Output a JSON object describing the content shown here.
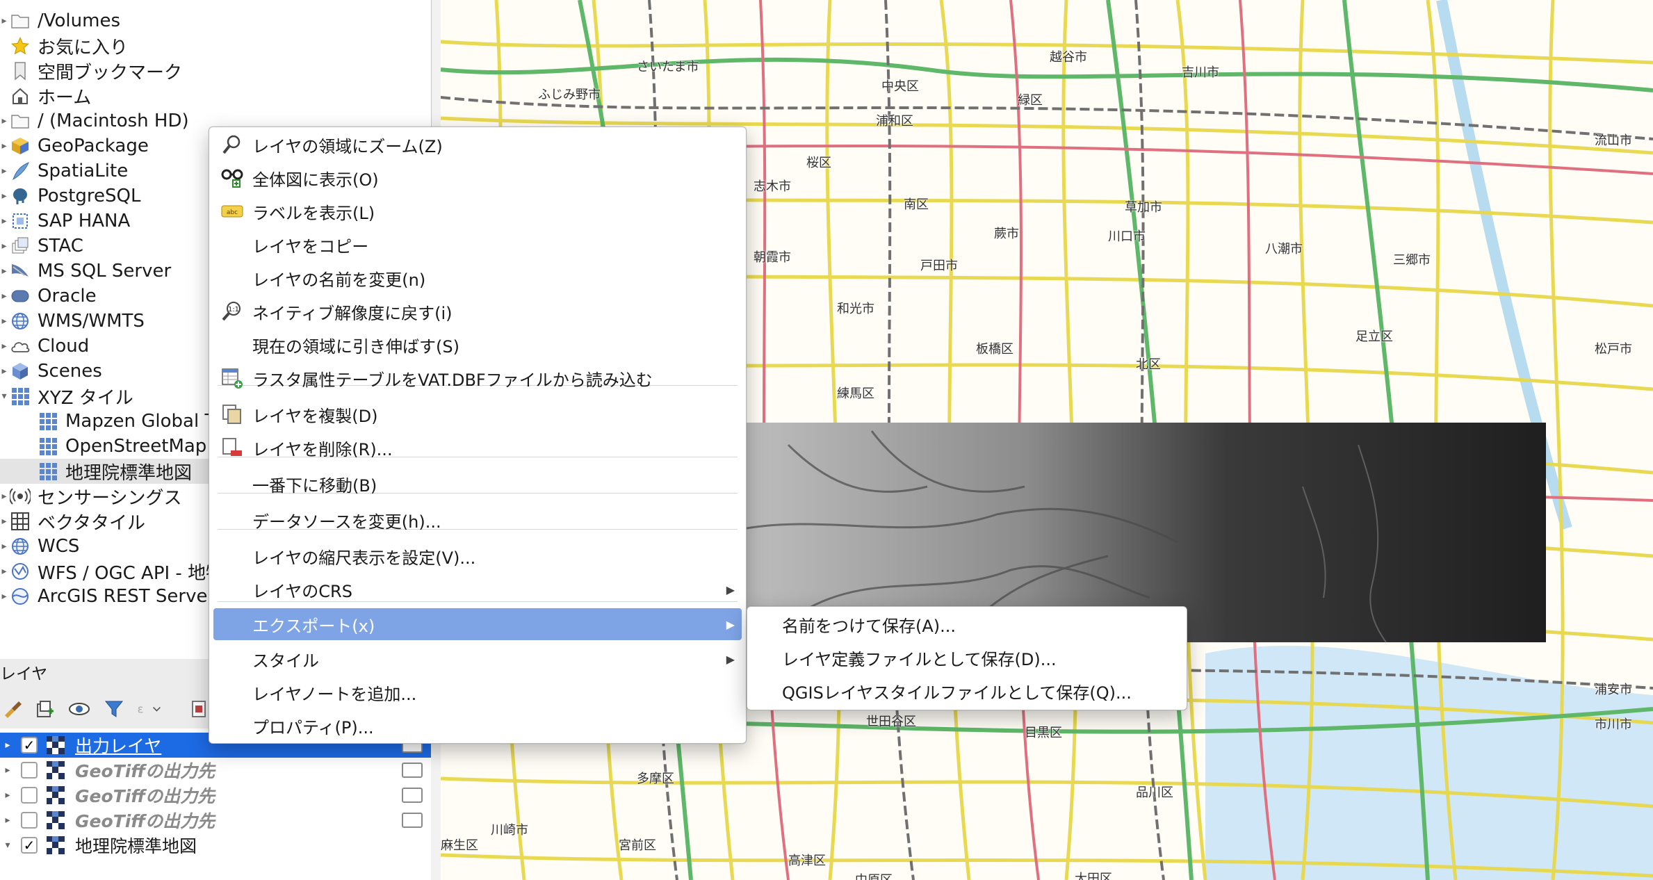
{
  "browser": {
    "items": [
      {
        "label": "/Volumes",
        "icon": "folder-icon"
      },
      {
        "label": "お気に入り",
        "icon": "star-icon"
      },
      {
        "label": "空間ブックマーク",
        "icon": "bookmark-icon"
      },
      {
        "label": "ホーム",
        "icon": "home-icon"
      },
      {
        "label": "/ (Macintosh HD)",
        "icon": "folder-icon"
      },
      {
        "label": "GeoPackage",
        "icon": "geopackage-icon"
      },
      {
        "label": "SpatiaLite",
        "icon": "spatialite-icon"
      },
      {
        "label": "PostgreSQL",
        "icon": "postgresql-icon"
      },
      {
        "label": "SAP HANA",
        "icon": "sap-hana-icon"
      },
      {
        "label": "STAC",
        "icon": "stac-icon"
      },
      {
        "label": "MS SQL Server",
        "icon": "mssql-icon"
      },
      {
        "label": "Oracle",
        "icon": "oracle-icon"
      },
      {
        "label": "WMS/WMTS",
        "icon": "globe-icon"
      },
      {
        "label": "Cloud",
        "icon": "cloud-icon"
      },
      {
        "label": "Scenes",
        "icon": "cube-icon"
      },
      {
        "label": "XYZ タイル",
        "icon": "grid-icon"
      },
      {
        "label": "Mapzen Global Terrain",
        "icon": "grid-icon"
      },
      {
        "label": "OpenStreetMap",
        "icon": "grid-icon"
      },
      {
        "label": "地理院標準地図",
        "icon": "grid-icon"
      },
      {
        "label": "センサーシングス",
        "icon": "sensor-icon"
      },
      {
        "label": "ベクタタイル",
        "icon": "vector-tile-icon"
      },
      {
        "label": "WCS",
        "icon": "globe-icon"
      },
      {
        "label": "WFS / OGC API - 地物",
        "icon": "wfs-icon"
      },
      {
        "label": "ArcGIS REST Servers",
        "icon": "arcgis-icon"
      }
    ]
  },
  "layers_panel": {
    "title": "レイヤ",
    "layers": [
      {
        "name": "出力レイヤ",
        "checked": true,
        "selected": true
      },
      {
        "name": "GeoTiffの出力先",
        "checked": false,
        "selected": false
      },
      {
        "name": "GeoTiffの出力先",
        "checked": false,
        "selected": false
      },
      {
        "name": "GeoTiffの出力先",
        "checked": false,
        "selected": false
      },
      {
        "name": "地理院標準地図",
        "checked": true,
        "selected": false
      }
    ],
    "check_mark": "✓"
  },
  "context_menu": {
    "items": [
      {
        "label": "レイヤの領域にズーム(Z)",
        "icon": "zoom-icon"
      },
      {
        "label": "全体図に表示(O)",
        "icon": "overview-icon"
      },
      {
        "label": "ラベルを表示(L)",
        "icon": "label-icon"
      },
      {
        "label": "レイヤをコピー",
        "icon": ""
      },
      {
        "label": "レイヤの名前を変更(n)",
        "icon": ""
      },
      {
        "label": "ネイティブ解像度に戻す(i)",
        "icon": "native-resolution-icon"
      },
      {
        "label": "現在の領域に引き伸ばす(S)",
        "icon": ""
      },
      {
        "label": "ラスタ属性テーブルをVAT.DBFファイルから読み込む",
        "icon": "attribute-table-icon"
      },
      {
        "label": "レイヤを複製(D)",
        "icon": "duplicate-icon"
      },
      {
        "label": "レイヤを削除(R)...",
        "icon": "remove-icon"
      },
      {
        "label": "一番下に移動(B)",
        "icon": ""
      },
      {
        "label": "データソースを変更(h)...",
        "icon": ""
      },
      {
        "label": "レイヤの縮尺表示を設定(V)...",
        "icon": ""
      },
      {
        "label": "レイヤのCRS",
        "icon": ""
      },
      {
        "label": "エクスポート(x)",
        "icon": ""
      },
      {
        "label": "スタイル",
        "icon": ""
      },
      {
        "label": "レイヤノートを追加...",
        "icon": ""
      },
      {
        "label": "プロパティ(P)...",
        "icon": ""
      }
    ],
    "submenu_arrow": "▶"
  },
  "export_submenu": {
    "items": [
      {
        "label": "名前をつけて保存(A)..."
      },
      {
        "label": "レイヤ定義ファイルとして保存(D)..."
      },
      {
        "label": "QGISレイヤスタイルファイルとして保存(Q)..."
      }
    ]
  },
  "map": {
    "labels": [
      "さいたま市",
      "ふじみ野市",
      "越谷市",
      "吉川市",
      "志木市",
      "朝霞市",
      "戸田市",
      "蕨市",
      "川口市",
      "草加市",
      "八潮市",
      "三郷市",
      "和光市",
      "練馬区",
      "板橋区",
      "北区",
      "足立区",
      "流山市",
      "松戸市",
      "世田谷区",
      "目黒区",
      "品川区",
      "多摩区",
      "川崎市",
      "麻生区",
      "宮前区",
      "高津区",
      "中原区",
      "大田区",
      "浦安市",
      "中央区",
      "桜区",
      "浦和区",
      "南区",
      "緑区",
      "市川市"
    ]
  },
  "colors": {
    "selection": "#1d6ae5",
    "menu_highlight": "#7fa4e6",
    "map_background": "#fffdf6"
  }
}
